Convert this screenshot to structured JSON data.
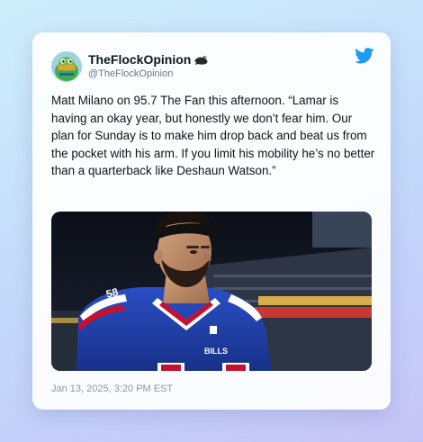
{
  "tweet": {
    "display_name": "TheFlockOpinion",
    "name_emoji_icon": "bird-icon",
    "handle": "@TheFlockOpinion",
    "text": "Matt Milano on 95.7 The Fan this afternoon. “Lamar is having an okay year, but honestly we don’t fear him. Our plan for Sunday is to make him drop back and beat us from the pocket with his arm. If you limit his mobility he’s no better than a quarterback like Deshaun Watson.”",
    "timestamp": "Jan 13, 2025, 3:20 PM EST",
    "photo": {
      "jersey_text": "BILLS",
      "sleeve_number": "58"
    }
  },
  "colors": {
    "twitter_blue": "#1d9bf0",
    "bills_blue": "#1f3ea8",
    "bills_red": "#c8102e"
  }
}
